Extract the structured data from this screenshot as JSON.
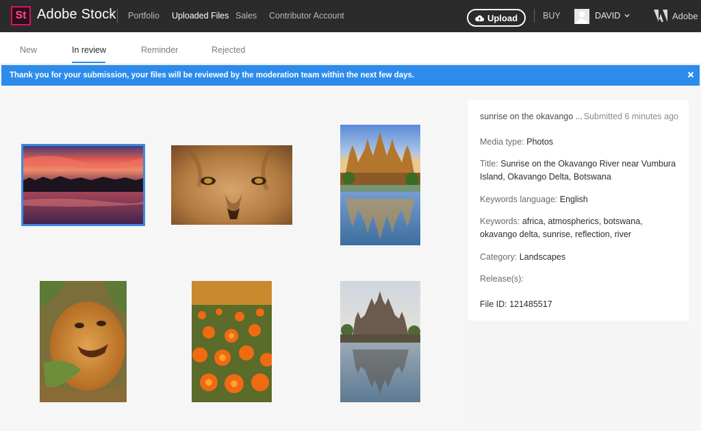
{
  "header": {
    "logo_text": "St",
    "brand": "Adobe Stock",
    "nav": [
      "Portfolio",
      "Uploaded Files",
      "Sales",
      "Contributor Account"
    ],
    "upload_label": "Upload",
    "buy_label": "BUY",
    "user_name": "DAVID",
    "adobe_label": "Adobe"
  },
  "tabs": [
    "New",
    "In review",
    "Reminder",
    "Rejected"
  ],
  "banner": {
    "message": "Thank you for your submission, your files will be reviewed by the moderation team within the next few days."
  },
  "gallery": [
    {
      "name": "sunset-river"
    },
    {
      "name": "lion-face"
    },
    {
      "name": "angkor-temple"
    },
    {
      "name": "lion-cub"
    },
    {
      "name": "orange-poppies"
    },
    {
      "name": "angkor-reflection"
    }
  ],
  "details": {
    "title_short": "sunrise on the okavango ...",
    "submitted": "Submitted 6 minutes ago",
    "media_type_label": "Media type:",
    "media_type": "Photos",
    "title_label": "Title:",
    "title": "Sunrise on the Okavango River near Vumbura Island, Okavango Delta, Botswana",
    "keywords_language_label": "Keywords language:",
    "keywords_language": "English",
    "keywords_label": "Keywords:",
    "keywords": "africa, atmospherics, botswana, okavango delta, sunrise, reflection, river",
    "category_label": "Category:",
    "category": "Landscapes",
    "releases_label": "Release(s):",
    "file_id_label": "File ID:",
    "file_id": "121485517"
  },
  "colors": {
    "accent": "#2d8ceb",
    "header_bg": "#2b2b2b",
    "logo_pink": "#e0115f"
  }
}
